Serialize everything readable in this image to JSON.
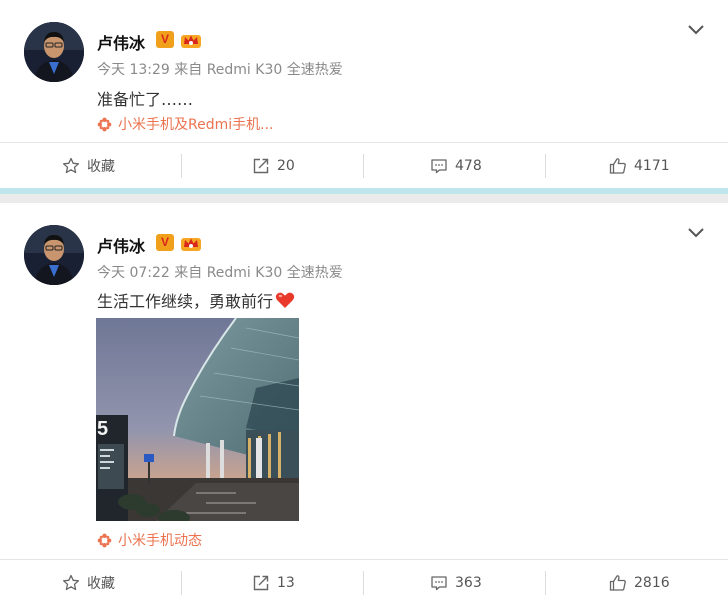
{
  "posts": [
    {
      "author": "卢伟冰",
      "time": "今天 13:29",
      "via": "来自 Redmi K30 全速热爱",
      "text": "准备忙了……",
      "source_tag": "小米手机及Redmi手机...",
      "actions": {
        "favorite": "收藏",
        "repost": "20",
        "comment": "478",
        "like": "4171"
      }
    },
    {
      "author": "卢伟冰",
      "time": "今天 07:22",
      "via": "来自 Redmi K30 全速热爱",
      "text": "生活工作继续，勇敢前行",
      "source_tag": "小米手机动态",
      "photo_sign": "5",
      "actions": {
        "favorite": "收藏",
        "repost": "13",
        "comment": "363",
        "like": "2816"
      }
    }
  ],
  "badge_v": "V",
  "colors": {
    "link": "#eb7350",
    "meta": "#8a8a8a",
    "divider": "#bfe6ec",
    "heart": "#e8392b"
  },
  "icons": [
    "star-icon",
    "repost-icon",
    "comment-icon",
    "thumbs-up-icon",
    "chevron-down-icon",
    "weibo-flower-icon",
    "heart-icon"
  ]
}
